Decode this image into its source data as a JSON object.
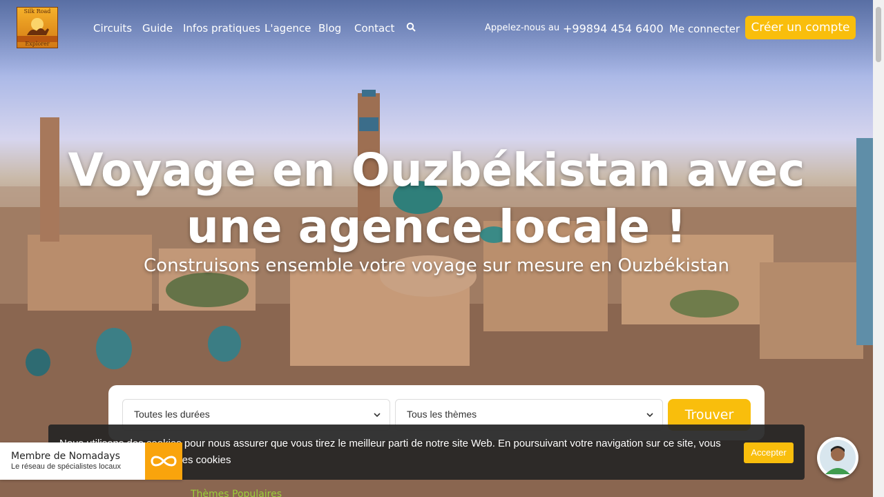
{
  "header": {
    "logo_top": "Silk Road",
    "logo_bottom": "Explorer",
    "nav": [
      "Circuits",
      "Guide",
      "Infos pratiques",
      "L'agence",
      "Blog",
      "Contact"
    ],
    "call_label": "Appelez-nous au",
    "phone": "+99894 454 6400",
    "login_label": "Me connecter",
    "signup_label": "Créer un compte"
  },
  "hero": {
    "title": "Voyage en Ouzbékistan avec une agence locale !",
    "subtitle": "Construisons ensemble votre voyage sur mesure en Ouzbékistan"
  },
  "search": {
    "duration_value": "Toutes les durées",
    "theme_value": "Tous les thèmes",
    "submit_label": "Trouver"
  },
  "cookie_banner": {
    "text": "Nous utilisons des cookies pour nous assurer que vous tirez le meilleur parti de notre site Web. En poursuivant votre navigation sur ce site, vous acceptez notre utilisation des cookies",
    "accept_label": "Accepter"
  },
  "badge": {
    "title": "Membre de Nomadays",
    "subtitle": "Le réseau de spécialistes locaux"
  },
  "below_fold_text": "Thèmes Populaires",
  "colors": {
    "accent": "#f9be0c",
    "cookie_bg": "#262626"
  },
  "icons": [
    "search-icon",
    "chevron-down-icon",
    "nomadays-infinity-icon",
    "chat-avatar"
  ]
}
